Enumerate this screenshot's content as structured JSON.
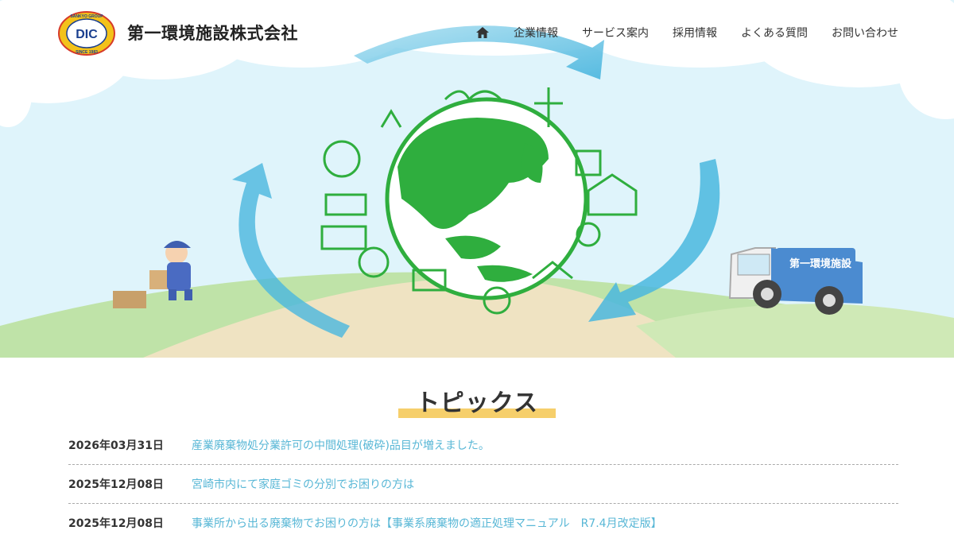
{
  "header": {
    "company_name": "第一環境施設株式会社",
    "logo": {
      "letters": "DIC",
      "ring_top": "SANKYO GROUP",
      "ring_bottom": "SINCE 1983"
    },
    "nav": {
      "home_icon": "home-icon",
      "items": [
        {
          "label": "企業情報"
        },
        {
          "label": "サービス案内"
        },
        {
          "label": "採用情報"
        },
        {
          "label": "よくある質問"
        },
        {
          "label": "お問い合わせ"
        }
      ]
    }
  },
  "hero": {
    "truck_label": "第一環境施設"
  },
  "topics": {
    "title": "トピックス",
    "items": [
      {
        "date": "2026年03月31日",
        "text": "産業廃棄物処分業許可の中間処理(破砕)品目が増えました。"
      },
      {
        "date": "2025年12月08日",
        "text": "宮崎市内にて家庭ゴミの分別でお困りの方は"
      },
      {
        "date": "2025年12月08日",
        "text": "事業所から出る廃棄物でお困りの方は【事業系廃棄物の適正処理マニュアル　R7.4月改定版】"
      }
    ]
  },
  "colors": {
    "sky": "#dff4fb",
    "earth_green": "#2fae3e",
    "arrow_blue": "#6cc3e3",
    "hill_green": "#bfe3a8",
    "path_beige": "#efe3c2",
    "link": "#58b7d6",
    "highlight": "#f6cf6b"
  }
}
